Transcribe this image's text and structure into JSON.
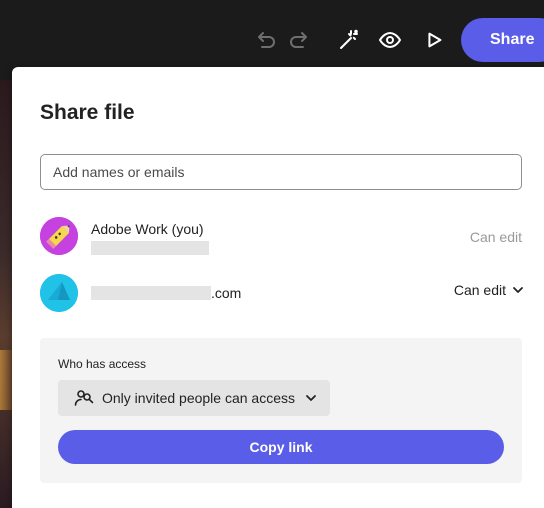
{
  "toolbar": {
    "icons": [
      "undo-icon",
      "redo-icon",
      "magic-wand-icon",
      "preview-eye-icon",
      "play-icon"
    ],
    "share_label": "Share",
    "accent_color": "#5a5de8"
  },
  "dialog": {
    "title": "Share file",
    "input": {
      "placeholder": "Add names or emails",
      "value": ""
    },
    "people": [
      {
        "name": "Adobe Work (you)",
        "avatar_icon": "pencil-avatar-icon",
        "permission": "Can edit"
      },
      {
        "email_suffix": ".com",
        "avatar_icon": "triangle-avatar-icon",
        "permission": "Can edit"
      }
    ],
    "access": {
      "label": "Who has access",
      "selected": "Only invited people can access",
      "icon": "people-icon"
    },
    "copy_link_label": "Copy link"
  }
}
